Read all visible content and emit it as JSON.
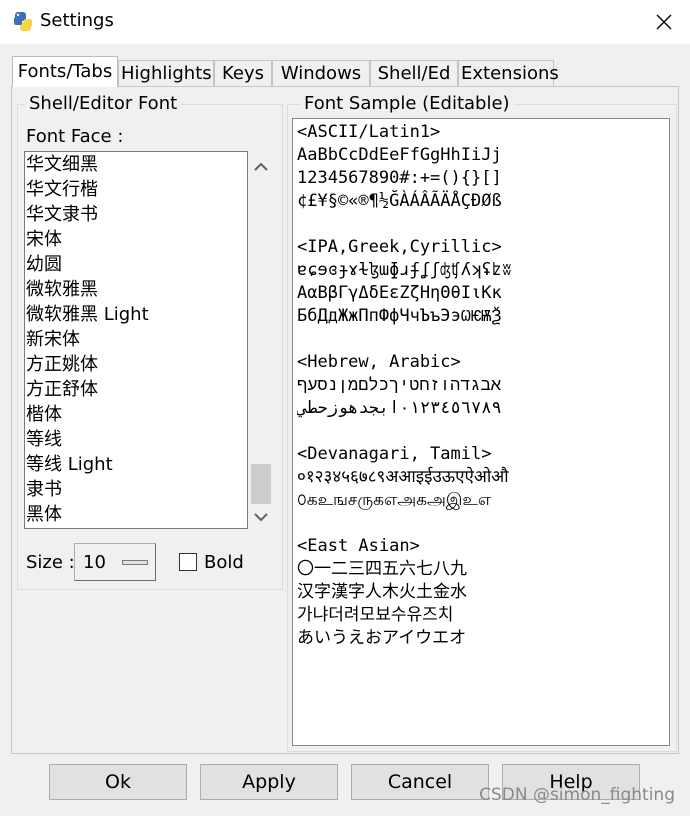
{
  "window": {
    "title": "Settings"
  },
  "tabs": [
    {
      "label": "Fonts/Tabs",
      "active": true
    },
    {
      "label": "Highlights"
    },
    {
      "label": "Keys"
    },
    {
      "label": "Windows"
    },
    {
      "label": "Shell/Ed"
    },
    {
      "label": "Extensions"
    }
  ],
  "font_group": {
    "title": "Shell/Editor Font",
    "face_label": "Font Face :",
    "faces": [
      "华文细黑",
      "华文行楷",
      "华文隶书",
      "宋体",
      "幼圆",
      "微软雅黑",
      "微软雅黑 Light",
      "新宋体",
      "方正姚体",
      "方正舒体",
      "楷体",
      "等线",
      "等线 Light",
      "隶书",
      "黑体"
    ],
    "size_label": "Size :",
    "size_value": "10",
    "bold_label": "Bold",
    "bold_checked": false
  },
  "sample_group": {
    "title": "Font Sample (Editable)",
    "lines": [
      "<ASCII/Latin1>",
      "AaBbCcDdEeFfGgHhIiJj",
      "1234567890#:+=(){}[]",
      "¢£¥§©«®¶½ĞÀÁÂÃÄÅÇÐØß",
      "",
      "<IPA,Greek,Cyrillic>",
      "ɐɕɘɞɟɤɫɮɯɸɹʄʆʃʤʧʎʞʢʫʬ",
      "ΑαΒβΓγΔδΕεΖζΗηΘθΙιΚκ",
      "БбДдЖжПпФфЧчЪъЭэѠѤѬѮ",
      "",
      "<Hebrew, Arabic>",
      "אבגדהוזחטיךכלםמןנסעף",
      "٠١٢٣٤٥٦٧٨٩ابجدهوزحطي",
      "",
      "<Devanagari, Tamil>",
      "०१२३४५६७८९अआइईउऊएऐओऔ",
      "௦கஉஙசருகஎஅகஅஇஉஎ",
      "",
      "<East Asian>",
      "〇一二三四五六七八九",
      "汉字漢字人木火土金水",
      "가냐더려모뵤수유즈치",
      "あいうえおアイウエオ"
    ]
  },
  "buttons": {
    "ok": "Ok",
    "apply": "Apply",
    "cancel": "Cancel",
    "help": "Help"
  },
  "watermark": "CSDN @simon_fighting"
}
